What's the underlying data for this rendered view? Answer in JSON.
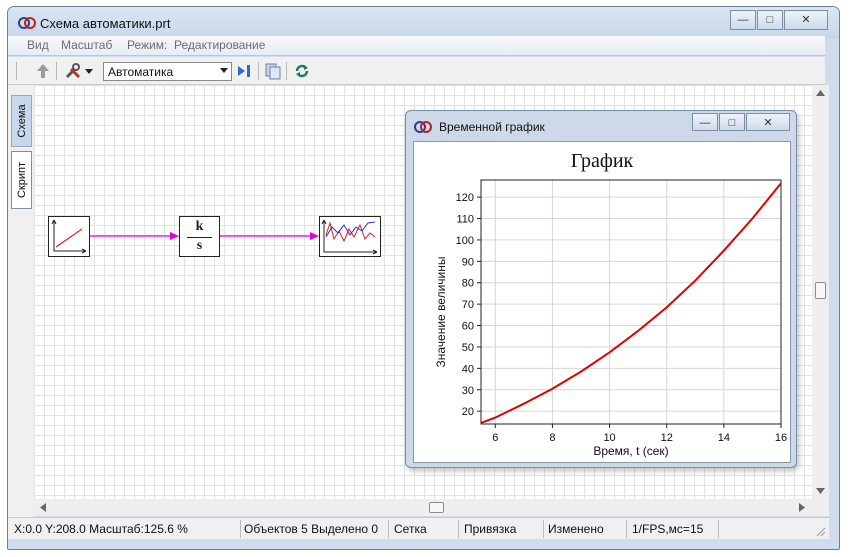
{
  "window": {
    "title": "Схема автоматики.prt",
    "buttons": {
      "minimize": "—",
      "maximize": "□",
      "close": "✕"
    }
  },
  "menu": {
    "items": [
      "Вид",
      "Масштаб",
      "Режим:",
      "Редактирование"
    ]
  },
  "toolbar": {
    "combo_value": "Автоматика",
    "icons": [
      "up-arrow-icon",
      "tools-icon",
      "dropdown-arrow-icon",
      "step-icon",
      "copy-icon",
      "refresh-icon"
    ]
  },
  "tabs": [
    "Схема",
    "Скрипт"
  ],
  "diagram": {
    "integrator_numerator": "k",
    "integrator_denominator": "s",
    "link_color": "#e000e0"
  },
  "graph_window": {
    "title": "Временной график",
    "buttons": {
      "minimize": "—",
      "maximize": "□",
      "close": "✕"
    }
  },
  "chart_data": {
    "type": "line",
    "title": "График",
    "xlabel": "Время, t (сек)",
    "ylabel": "Значение величины",
    "xlim": [
      5.5,
      16
    ],
    "ylim": [
      14,
      128
    ],
    "xticks": [
      6,
      8,
      10,
      12,
      14,
      16
    ],
    "yticks": [
      20,
      30,
      40,
      50,
      60,
      70,
      80,
      90,
      100,
      110,
      120
    ],
    "grid": true,
    "series": [
      {
        "color": "#e00000",
        "x": [
          5.5,
          6,
          7,
          8,
          9,
          10,
          11,
          12,
          13,
          14,
          15,
          16
        ],
        "y": [
          14.5,
          17,
          23.5,
          30.5,
          38.5,
          47.5,
          57.5,
          68.5,
          81,
          95,
          110,
          126.5
        ]
      }
    ]
  },
  "status": {
    "coords": "X:0.0  Y:208.0  Масштаб:125.6 %",
    "objects": "Объектов 5  Выделено 0",
    "grid": "Сетка",
    "snap": "Привязка",
    "modified": "Изменено",
    "fps": "1/FPS,мс=15"
  }
}
